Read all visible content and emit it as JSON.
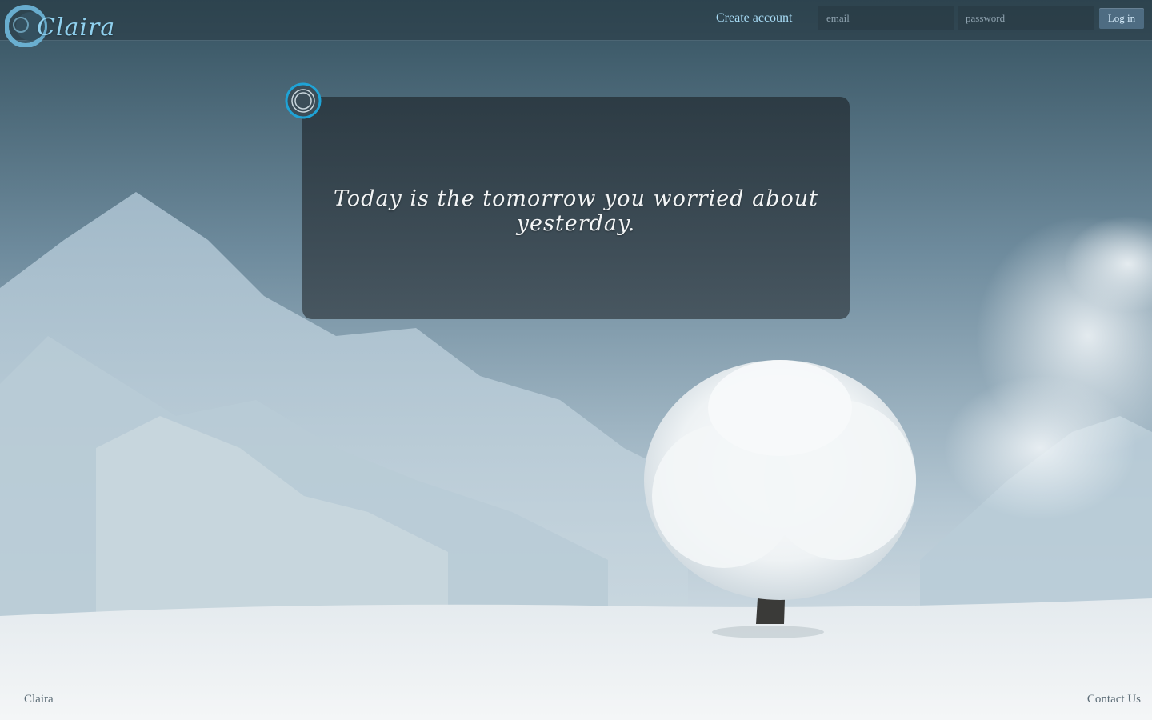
{
  "brand": {
    "name": "Claira",
    "logo_icon": "swirl-moon-logo-icon"
  },
  "header": {
    "create_account_label": "Create account",
    "email_placeholder": "email",
    "email_value": "",
    "password_placeholder": "password",
    "password_value": "",
    "login_label": "Log in"
  },
  "quote": {
    "text": "Today is the tomorrow you worried about yesterday.",
    "badge_icon": "concentric-circle-icon"
  },
  "footer": {
    "left_label": "Claira",
    "right_label": "Contact Us"
  },
  "colors": {
    "accent": "#8fd0ee",
    "badge_ring": "#1fa3d6",
    "button": "#4e6c82",
    "sky_top": "#3c5a6e",
    "snow": "#eef2f4"
  },
  "background": {
    "scene": "snowy mountains with frosted tree"
  }
}
